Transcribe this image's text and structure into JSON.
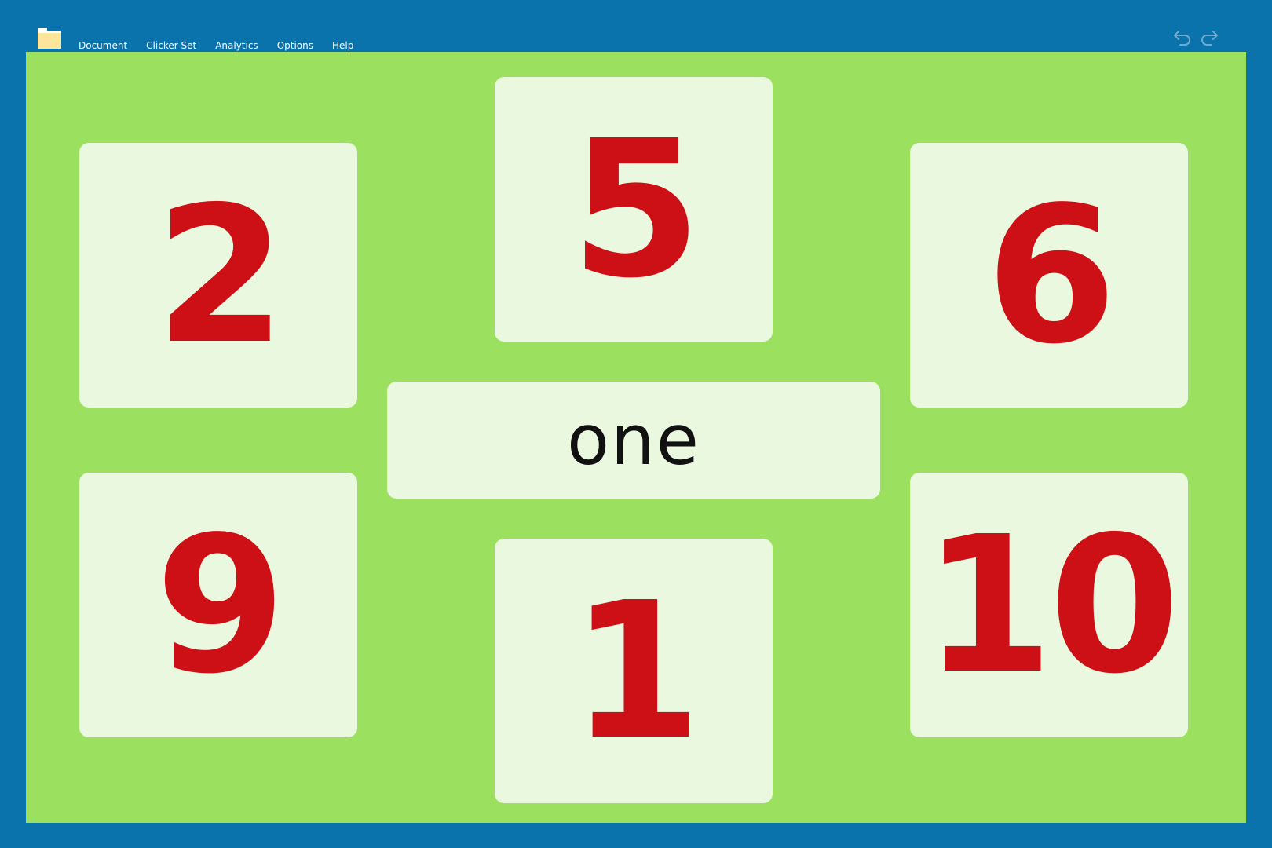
{
  "menu": {
    "items": [
      "Document",
      "Clicker Set",
      "Analytics",
      "Options",
      "Help"
    ]
  },
  "icons": {
    "folder": "folder-icon",
    "undo": "undo-icon",
    "redo": "redo-icon"
  },
  "colors": {
    "frame": "#0a73ab",
    "canvas": "#9be15f",
    "card": "#eaf8e0",
    "number": "#cc1016",
    "word": "#111111"
  },
  "cards": {
    "top_left": "2",
    "top_center": "5",
    "top_right": "6",
    "bottom_left": "9",
    "bottom_center": "1",
    "bottom_right": "10"
  },
  "prompt": {
    "word": "one"
  }
}
